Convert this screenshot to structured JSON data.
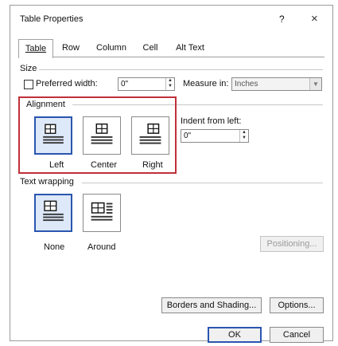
{
  "dialog": {
    "title": "Table Properties",
    "help_label": "?",
    "close_label": "×"
  },
  "tabs": [
    {
      "label": "Table",
      "active": true
    },
    {
      "label": "Row",
      "active": false
    },
    {
      "label": "Column",
      "active": false
    },
    {
      "label": "Cell",
      "active": false
    },
    {
      "label": "Alt Text",
      "active": false
    }
  ],
  "size": {
    "section_label": "Size",
    "preferred_width_label": "Preferred width:",
    "preferred_width_checked": false,
    "preferred_width_value": "0\"",
    "measure_in_label": "Measure in:",
    "measure_in_value": "Inches"
  },
  "alignment": {
    "section_label": "Alignment",
    "options": [
      {
        "label": "Left",
        "selected": true
      },
      {
        "label": "Center",
        "selected": false
      },
      {
        "label": "Right",
        "selected": false
      }
    ],
    "indent_label": "Indent from left:",
    "indent_value": "0\"",
    "highlight_color": "#c0303a"
  },
  "text_wrapping": {
    "section_label": "Text wrapping",
    "options": [
      {
        "label": "None",
        "selected": true
      },
      {
        "label": "Around",
        "selected": false
      }
    ],
    "positioning_label": "Positioning..."
  },
  "buttons": {
    "borders_label": "Borders and Shading...",
    "options_label": "Options...",
    "ok_label": "OK",
    "cancel_label": "Cancel"
  },
  "colors": {
    "selection_border": "#2a55b0",
    "selection_fill": "#dde8f8"
  }
}
